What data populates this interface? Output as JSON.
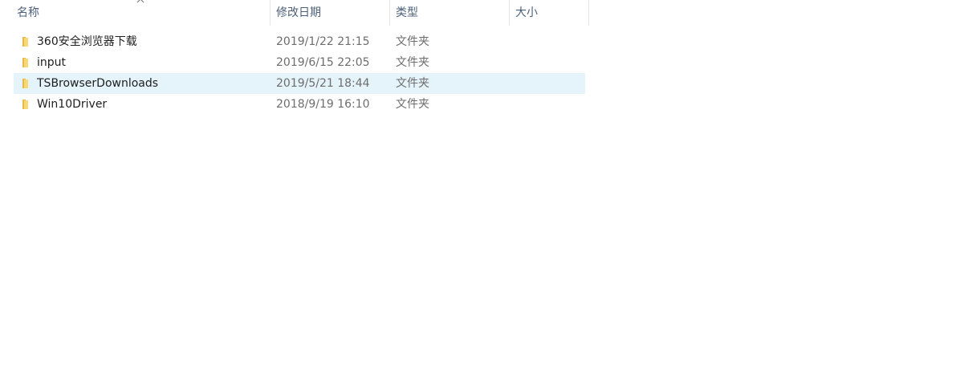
{
  "columns": {
    "name": "名称",
    "modified": "修改日期",
    "type": "类型",
    "size": "大小"
  },
  "sort": {
    "column": "name",
    "direction": "ascending",
    "icon": "chevron-up-icon"
  },
  "files": [
    {
      "name": "360安全浏览器下载",
      "modified": "2019/1/22 21:15",
      "type": "文件夹",
      "icon": "folder-icon",
      "hovered": false
    },
    {
      "name": "input",
      "modified": "2019/6/15 22:05",
      "type": "文件夹",
      "icon": "folder-icon",
      "hovered": false
    },
    {
      "name": "TSBrowserDownloads",
      "modified": "2019/5/21 18:44",
      "type": "文件夹",
      "icon": "folder-icon",
      "hovered": true
    },
    {
      "name": "Win10Driver",
      "modified": "2018/9/19 16:10",
      "type": "文件夹",
      "icon": "folder-icon",
      "hovered": false
    }
  ],
  "colors": {
    "hover_row": "#e5f3fb",
    "header_text": "#4c607a",
    "folder_yellow": "#f8d775"
  }
}
